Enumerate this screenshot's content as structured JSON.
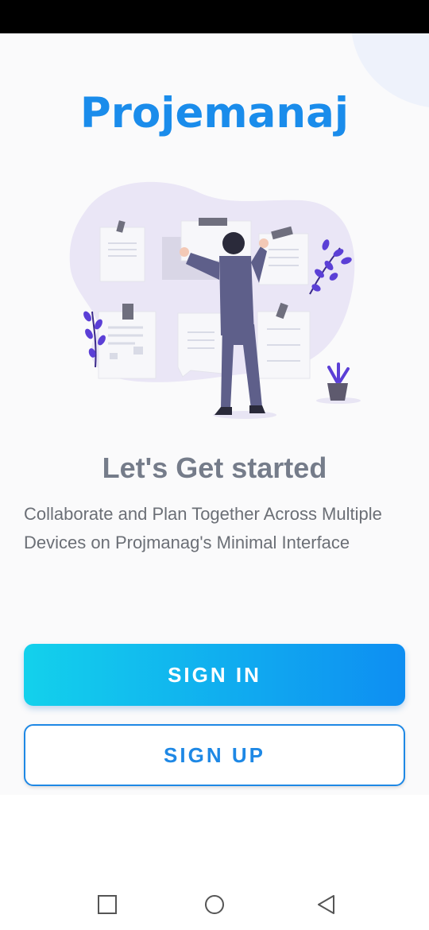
{
  "app": {
    "title": "Projemanaj"
  },
  "onboarding": {
    "headline": "Let's Get started",
    "subtitle": "Collaborate and Plan Together Across Multiple Devices on Projmanag's Minimal Interface"
  },
  "actions": {
    "sign_in_label": "SIGN IN",
    "sign_up_label": "SIGN UP"
  },
  "navigation": {
    "buttons": [
      "recent-apps-icon",
      "home-icon",
      "back-icon"
    ]
  },
  "colors": {
    "brand": "#1a8ceb",
    "gradient_start": "#13d1ec",
    "gradient_end": "#0e8ef2",
    "headline": "#757c8a",
    "accent_plant": "#5b3fd6"
  }
}
